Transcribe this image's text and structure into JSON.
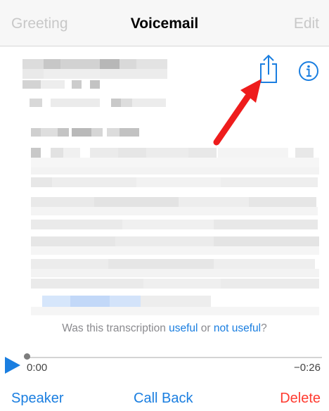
{
  "nav": {
    "left_label": "Greeting",
    "title": "Voicemail",
    "right_label": "Edit"
  },
  "icons": {
    "share": "share-icon",
    "info": "info-icon",
    "play": "play-icon",
    "annotation": "red-arrow"
  },
  "feedback": {
    "prefix": "Was this transcription ",
    "useful": "useful",
    "middle": " or ",
    "not_useful": "not useful",
    "suffix": "?"
  },
  "player": {
    "elapsed": "0:00",
    "remaining": "−0:26",
    "progress": 0
  },
  "actions": {
    "speaker": "Speaker",
    "call_back": "Call Back",
    "delete": "Delete"
  },
  "colors": {
    "accent": "#1a7ee0",
    "destructive": "#ff3b30",
    "annotation": "#ee1c1c"
  }
}
